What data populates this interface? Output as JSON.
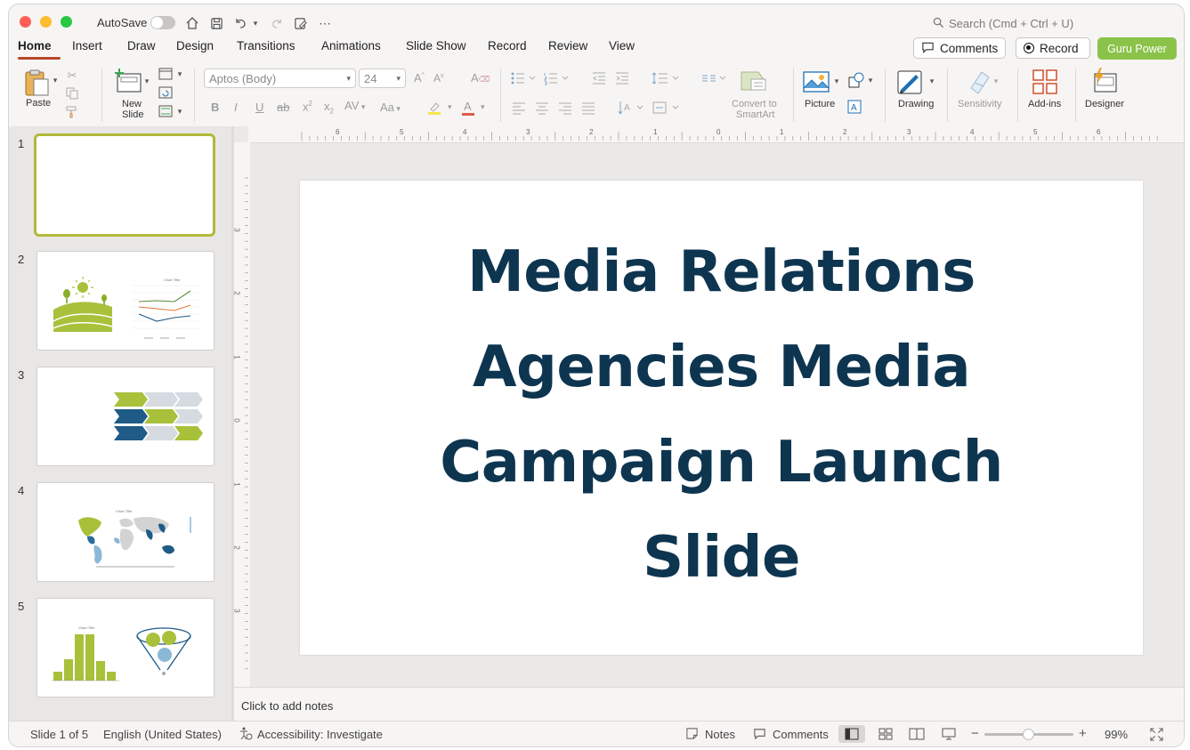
{
  "titlebar": {
    "autosave_label": "AutoSave",
    "search_placeholder": "Search (Cmd + Ctrl + U)"
  },
  "tabs": [
    "Home",
    "Insert",
    "Draw",
    "Design",
    "Transitions",
    "Animations",
    "Slide Show",
    "Record",
    "Review",
    "View"
  ],
  "header_buttons": {
    "comments": "Comments",
    "record": "Record",
    "guru": "Guru Power"
  },
  "ribbon": {
    "paste": "Paste",
    "new_slide_line1": "New",
    "new_slide_line2": "Slide",
    "font_name": "Aptos (Body)",
    "font_size": "24",
    "convert_line1": "Convert to",
    "convert_line2": "SmartArt",
    "picture": "Picture",
    "drawing": "Drawing",
    "sensitivity": "Sensitivity",
    "addins": "Add-ins",
    "designer": "Designer"
  },
  "colors": {
    "accent_green": "#8bc34a",
    "title_color": "#0e3550",
    "underline_red": "#b7472a",
    "thumb_green": "#a7c13b",
    "thumb_blue": "#1f5b86"
  },
  "thumbnails": [
    {
      "number": "1"
    },
    {
      "number": "2",
      "chart_title": "Chart Title"
    },
    {
      "number": "3"
    },
    {
      "number": "4",
      "chart_title": "Chart Title"
    },
    {
      "number": "5",
      "chart_title": "Chart Title"
    }
  ],
  "ruler": {
    "h": [
      "6",
      "5",
      "4",
      "3",
      "2",
      "1",
      "0",
      "1",
      "2",
      "3",
      "4",
      "5",
      "6"
    ],
    "v": [
      "3",
      "2",
      "1",
      "0",
      "1",
      "2",
      "3"
    ]
  },
  "slide": {
    "title": "Media Relations Agencies Media Campaign Launch Slide"
  },
  "notes_placeholder": "Click to add notes",
  "statusbar": {
    "slide_count": "Slide 1 of 5",
    "language": "English (United States)",
    "accessibility": "Accessibility: Investigate",
    "notes": "Notes",
    "comments": "Comments",
    "zoom": "99%"
  }
}
